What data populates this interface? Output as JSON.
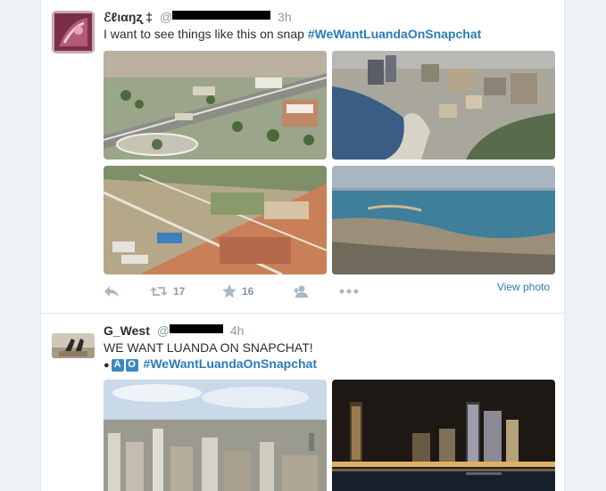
{
  "tweets": [
    {
      "display_name": "ℰℓιαŋʐ ‡",
      "handle_prefix": "@",
      "time": "3h",
      "text_plain": "I want to see things like this on snap ",
      "hashtag": "#WeWantLuandaOnSnapchat",
      "actions": {
        "reply_icon": "reply-icon",
        "retweet_icon": "retweet-icon",
        "retweet_count": "17",
        "favorite_icon": "star-icon",
        "favorite_count": "16",
        "follow_icon": "follow-icon",
        "more_icon": "more-icon"
      },
      "view_photo_label": "View photo",
      "photos": [
        "aerial-city-roundabout",
        "coastal-bay-city",
        "housing-development-aerial",
        "bay-coastline-aerial"
      ]
    },
    {
      "display_name": "G_West",
      "handle_prefix": "@",
      "time": "4h",
      "line1": "WE WANT LUANDA ON SNAPCHAT!",
      "symbol_a": "A",
      "symbol_o": "O",
      "hashtag": "#WeWantLuandaOnSnapchat",
      "photos": [
        "city-skyline-day",
        "city-skyline-night"
      ]
    }
  ],
  "colors": {
    "link": "#2b7bb9",
    "name": "#292f33",
    "meta": "#8899a6",
    "icon": "#aab8c2"
  }
}
